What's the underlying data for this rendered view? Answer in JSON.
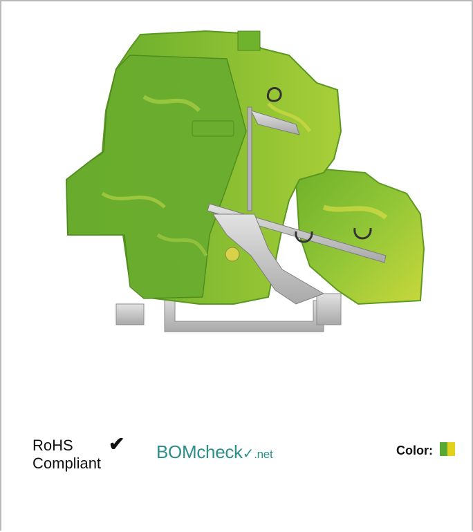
{
  "product": {
    "image_icon": "terminal-block-product-photo",
    "housing_color": "#7fbf2e",
    "accent_color": "#d8dc3a",
    "metal_color": "#c9c9c9"
  },
  "badges": {
    "rohs_line1": "RoHS",
    "rohs_line2": "Compliant",
    "rohs_check": "✔",
    "bomcheck_bom": "BOM",
    "bomcheck_check": "check",
    "bomcheck_tick": "✓",
    "bomcheck_net": ".net"
  },
  "color": {
    "label": "Color:",
    "swatch_colors": [
      "#58a833",
      "#e2d21c"
    ]
  }
}
